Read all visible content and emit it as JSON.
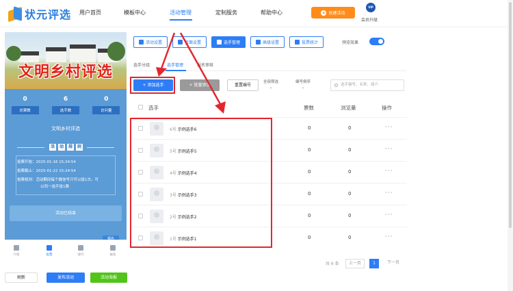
{
  "brand": {
    "name": "状元评选"
  },
  "nav": {
    "items": [
      "用户首页",
      "模板中心",
      "活动管理",
      "定制服务",
      "帮助中心"
    ],
    "active": "活动管理",
    "create_label": "创建活动",
    "vip_badge": "VIP",
    "vip_label": "会员升级"
  },
  "preview": {
    "banner_title": "文明乡村评选",
    "stats": [
      {
        "value": "0",
        "label": "总票数"
      },
      {
        "value": "6",
        "label": "选手数"
      },
      {
        "value": "0",
        "label": "访问量"
      }
    ],
    "activity_title": "文明乡村评选",
    "rules_chars": [
      "活",
      "动",
      "规",
      "则"
    ],
    "rules": [
      "投票开始：2025-01-16 15:24:54",
      "投票截止：2025-01-22 15:24:54",
      "投票规则：活动期间每个微信号只可以投1次，可",
      "以同一选手投1票"
    ],
    "ended_label": "活动已结束",
    "report_label": "报名",
    "tabs": [
      {
        "label": "介绍",
        "icon": "home-icon"
      },
      {
        "label": "投票",
        "icon": "flag-icon"
      },
      {
        "label": "排行",
        "icon": "bar-chart-icon"
      },
      {
        "label": "报名",
        "icon": "user-plus-icon"
      }
    ],
    "active_tab": "投票"
  },
  "bottom_buttons": {
    "refresh": "刷新",
    "publish": "发布活动",
    "poster": "活动海报"
  },
  "settings_tabs": [
    "活动设置",
    "页面设置",
    "选手管理",
    "高级设置",
    "投票统计"
  ],
  "active_settings_tab": "选手管理",
  "preview_toggle": {
    "label": "预览效果",
    "on": true
  },
  "subtabs": [
    "选手分组",
    "选手管理",
    "报名审核"
  ],
  "active_subtab": "选手管理",
  "toolbar": {
    "add": "+ 添加选手",
    "batch": "+ 批量添加",
    "reorder": "重置编号",
    "filter_all": [
      "全部筛选",
      "⌄"
    ],
    "sort": [
      "编号倒序",
      "⌄"
    ],
    "search_placeholder": "选手编号、名称、简介"
  },
  "table": {
    "headers": {
      "name": "选手",
      "votes": "票数",
      "views": "浏览量",
      "ops": "操作"
    },
    "rows": [
      {
        "num": "6号",
        "name": "示例选手6",
        "votes": "0",
        "views": "0",
        "ops": "···"
      },
      {
        "num": "5号",
        "name": "示例选手5",
        "votes": "0",
        "views": "0",
        "ops": "···"
      },
      {
        "num": "4号",
        "name": "示例选手4",
        "votes": "0",
        "views": "0",
        "ops": "···"
      },
      {
        "num": "3号",
        "name": "示例选手3",
        "votes": "0",
        "views": "0",
        "ops": "···"
      },
      {
        "num": "2号",
        "name": "示例选手2",
        "votes": "0",
        "views": "0",
        "ops": "···"
      },
      {
        "num": "1号",
        "name": "示例选手1",
        "votes": "0",
        "views": "0",
        "ops": "···"
      }
    ]
  },
  "pagination": {
    "total": "共 6 条",
    "prev": "上一页",
    "current": "1",
    "next": "下一页"
  },
  "colors": {
    "primary": "#2d7df6",
    "orange": "#ff8c1a",
    "green": "#52c41a",
    "annotation": "#e3262e"
  }
}
